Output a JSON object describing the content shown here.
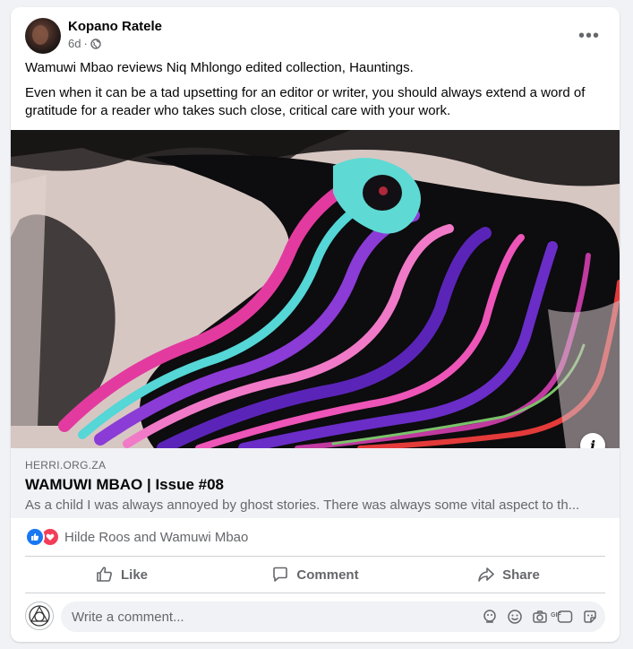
{
  "post": {
    "author": "Kopano Ratele",
    "time": "6d",
    "separator": "·",
    "more_label": "•••",
    "text_line1": "Wamuwi Mbao reviews Niq Mhlongo edited collection, Hauntings.",
    "text_line2": "Even when it can be a tad upsetting for an editor or writer, you should always extend a word of gratitude for a reader who takes such close, critical care with your work."
  },
  "link_preview": {
    "domain": "HERRI.ORG.ZA",
    "title": "WAMUWI MBAO | Issue #08",
    "description": "As a child I was always annoyed by ghost stories. There was always some vital aspect to th...",
    "info_label": "i"
  },
  "reactions": {
    "names": "Hilde Roos and Wamuwi Mbao",
    "icons": [
      "like-icon",
      "love-icon"
    ]
  },
  "actions": {
    "like": "Like",
    "comment": "Comment",
    "share": "Share"
  },
  "comment_box": {
    "placeholder": "Write a comment...",
    "tools": [
      "avatar-sticker-icon",
      "emoji-icon",
      "camera-icon",
      "gif-icon",
      "sticker-icon"
    ],
    "gif_label": "GIF"
  },
  "colors": {
    "accent": "#1877f2",
    "love": "#f33e58",
    "secondary_text": "#65676b",
    "background": "#f0f2f5"
  }
}
